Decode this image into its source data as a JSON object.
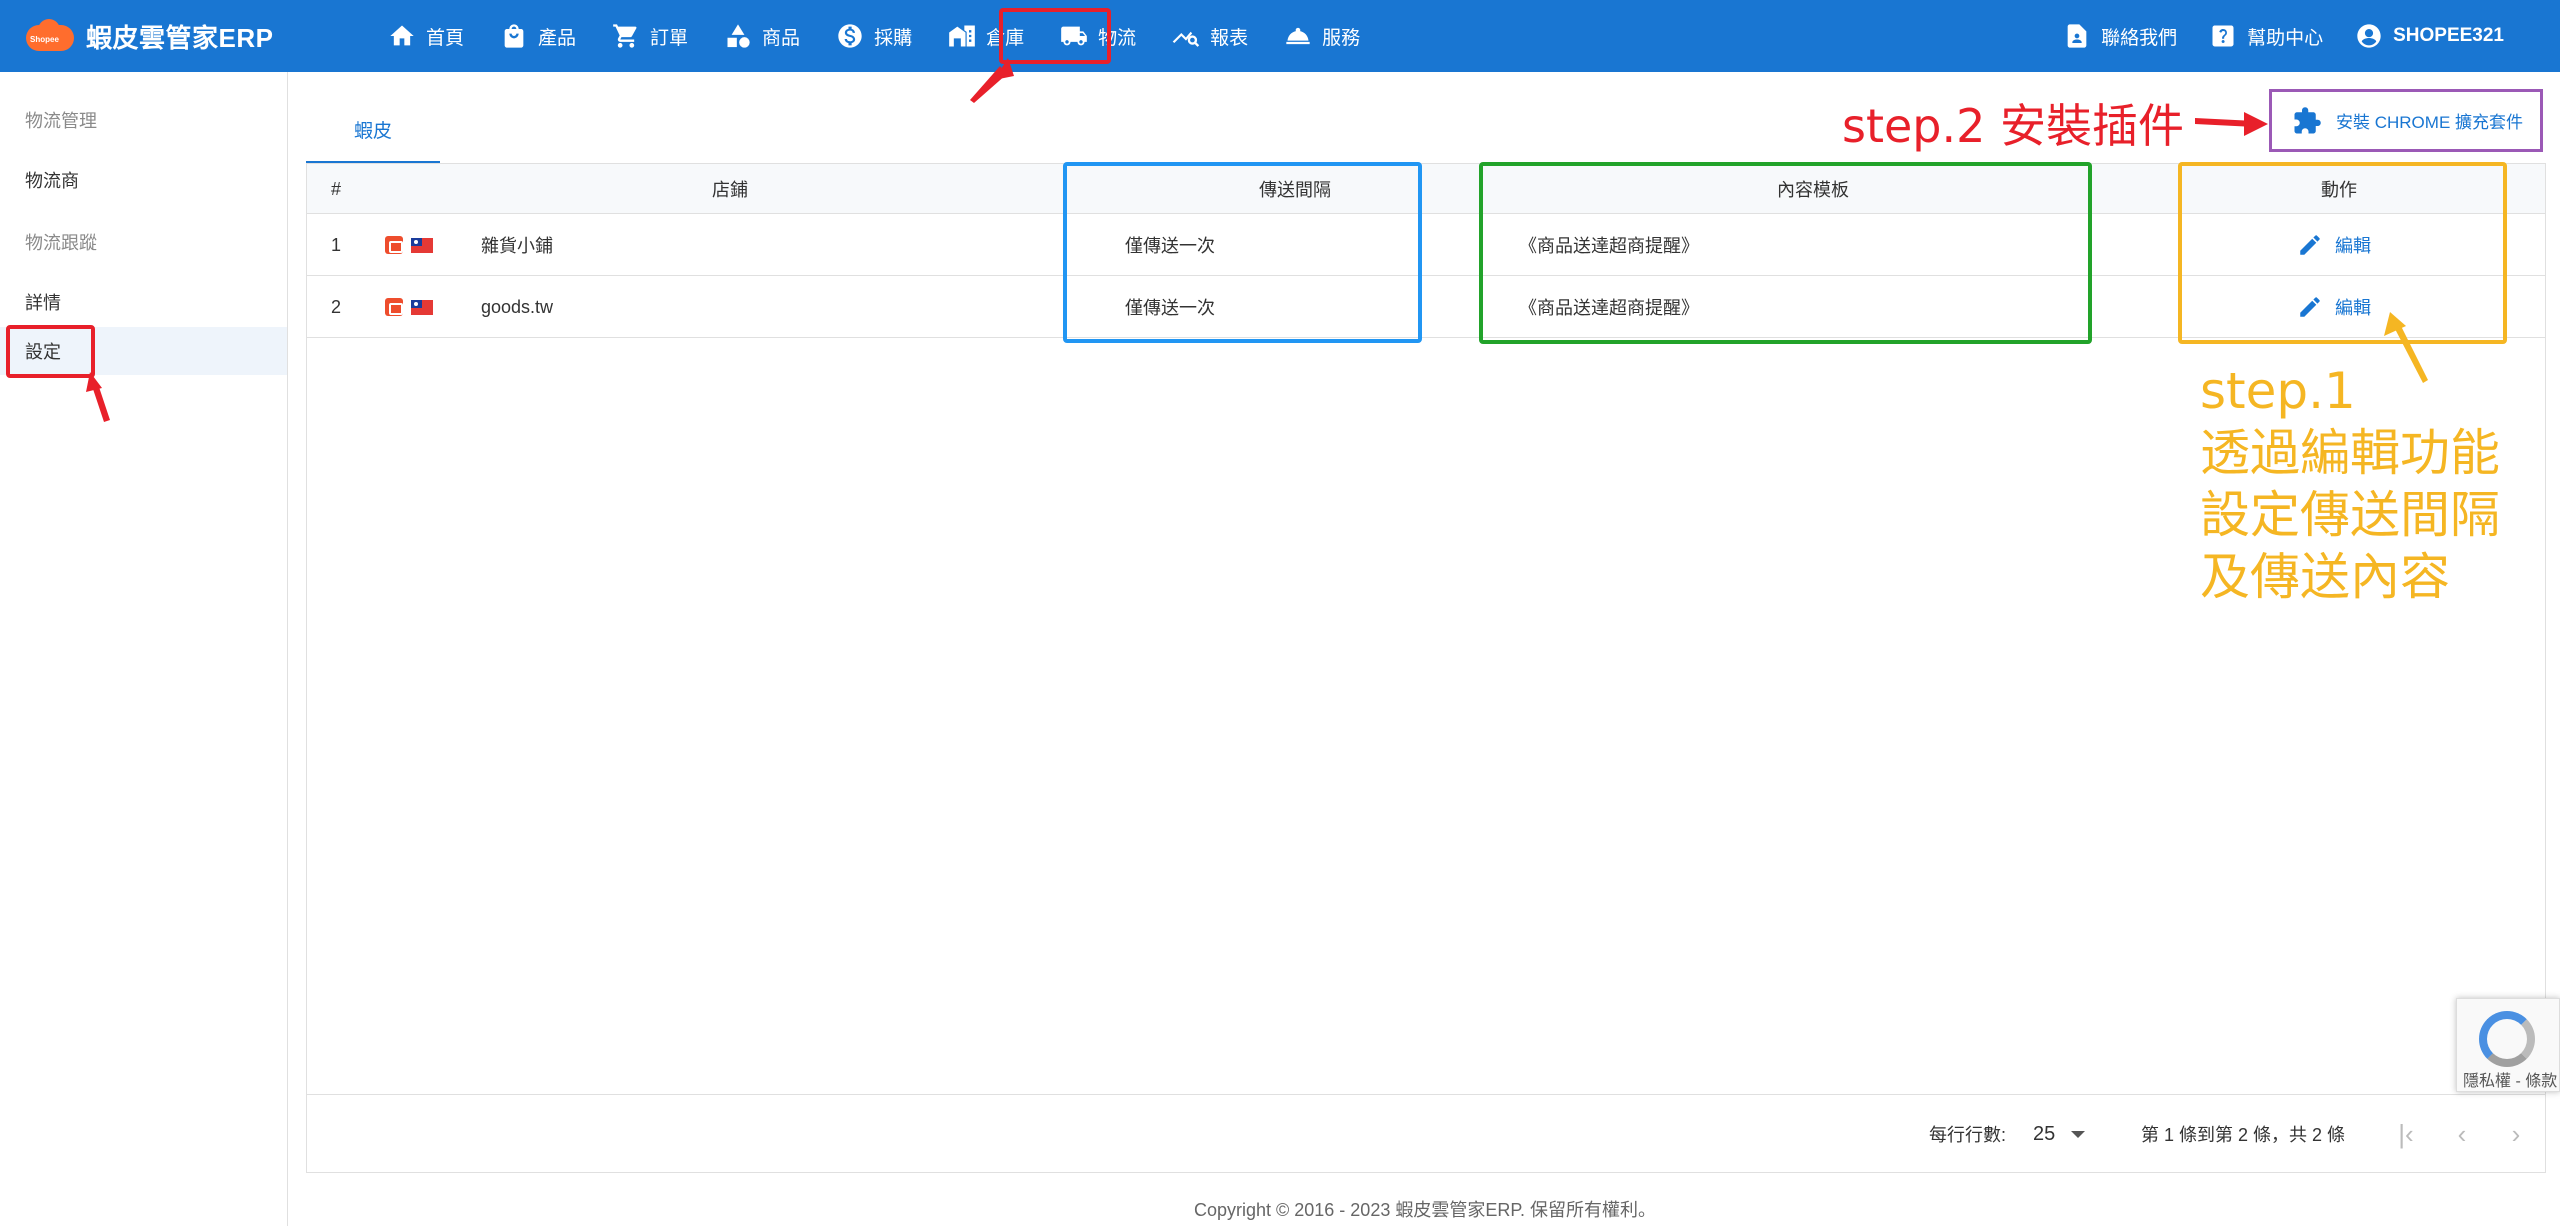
{
  "brand": {
    "name": "蝦皮雲管家ERP",
    "logo_text": "Shopee"
  },
  "nav": [
    {
      "label": "首頁",
      "icon": "home-icon"
    },
    {
      "label": "產品",
      "icon": "bag-icon"
    },
    {
      "label": "訂單",
      "icon": "cart-icon"
    },
    {
      "label": "商品",
      "icon": "shapes-icon"
    },
    {
      "label": "採購",
      "icon": "dollar-icon"
    },
    {
      "label": "倉庫",
      "icon": "warehouse-icon"
    },
    {
      "label": "物流",
      "icon": "truck-icon"
    },
    {
      "label": "報表",
      "icon": "chart-icon"
    },
    {
      "label": "服務",
      "icon": "bell-icon"
    }
  ],
  "nav_right": [
    {
      "label": "聯絡我們",
      "icon": "contact-icon"
    },
    {
      "label": "幫助中心",
      "icon": "help-icon"
    },
    {
      "label": "SHOPEE321",
      "icon": "account-icon"
    }
  ],
  "sidebar": [
    {
      "label": "物流管理"
    },
    {
      "label": "物流商"
    },
    {
      "label": "物流跟蹤"
    },
    {
      "label": "詳情"
    },
    {
      "label": "設定"
    }
  ],
  "tabs": [
    {
      "label": "蝦皮"
    }
  ],
  "chrome_button": {
    "label": "安裝 CHROME 擴充套件"
  },
  "table": {
    "headers": {
      "index": "#",
      "store": "店鋪",
      "interval": "傳送間隔",
      "template": "內容模板",
      "action": "動作"
    },
    "rows": [
      {
        "index": "1",
        "store": "雜貨小鋪",
        "interval": "僅傳送一次",
        "template": "《商品送達超商提醒》",
        "action": "編輯"
      },
      {
        "index": "2",
        "store": "goods.tw",
        "interval": "僅傳送一次",
        "template": "《商品送達超商提醒》",
        "action": "編輯"
      }
    ]
  },
  "pagination": {
    "rows_per_page_label": "每行行數:",
    "rows_per_page": "25",
    "range": "第 1 條到第 2 條，共 2 條"
  },
  "copyright": "Copyright © 2016 - 2023 蝦皮雲管家ERP. 保留所有權利。",
  "annotations": {
    "step2": "step.2 安裝插件",
    "step1_lines": [
      "step.1",
      "透過編輯功能",
      "設定傳送間隔",
      "及傳送內容"
    ]
  },
  "recaptcha": {
    "text": "隱私權 - 條款"
  },
  "colors": {
    "primary": "#1976d2",
    "red": "#e8202a",
    "blue_box": "#2196f3",
    "green_box": "#22a32a",
    "yellow_box": "#f5b623",
    "purple_box": "#9b59b6"
  }
}
